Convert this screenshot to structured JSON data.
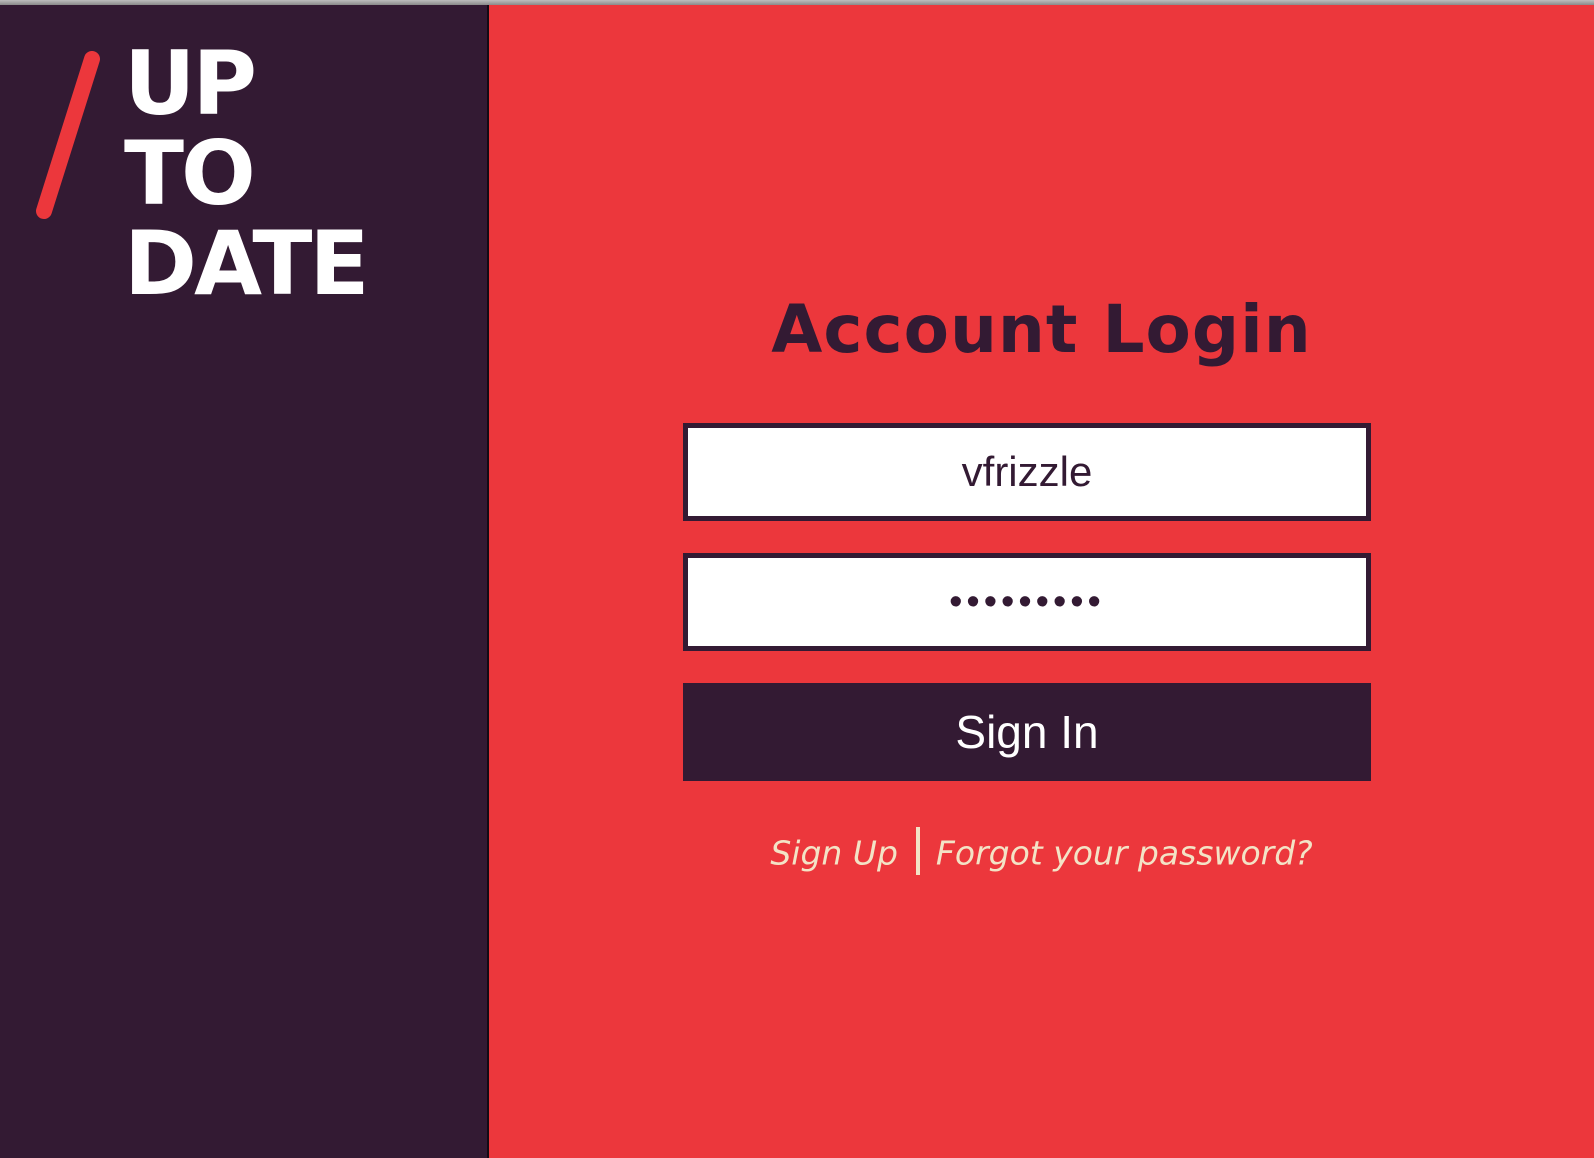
{
  "brand": {
    "logo_lines": [
      "UP",
      "TO",
      "DATE"
    ],
    "primary_color": "#331a33",
    "accent_color": "#ec373c",
    "link_color": "#f3e3c6"
  },
  "login": {
    "title": "Account Login",
    "username_value": "vfrizzle",
    "password_mask": "•••••••••",
    "signin_label": "Sign In",
    "signup_label": "Sign Up",
    "forgot_label": "Forgot your password?"
  }
}
